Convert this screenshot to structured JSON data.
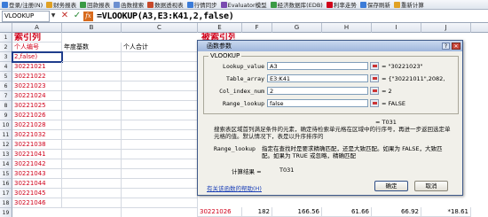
{
  "toolbar": {
    "items": [
      {
        "label": "登录/注册(N)",
        "icon": "user-icon",
        "color": "#3b7bd8"
      },
      {
        "label": "财务报表",
        "icon": "report-icon",
        "color": "#e0a124"
      },
      {
        "label": "回款报表",
        "icon": "report-icon",
        "color": "#3a9a45"
      },
      {
        "label": "函数搜索",
        "icon": "search-icon",
        "color": "#6b8fd0"
      },
      {
        "label": "数据透视表",
        "icon": "table-icon",
        "color": "#c7492b"
      },
      {
        "label": "行情同步",
        "icon": "sync-icon",
        "color": "#3b7bd8"
      },
      {
        "label": "Evaluator模型",
        "icon": "model-icon",
        "color": "#7a4ab0"
      },
      {
        "label": "经济数据库(EDB)",
        "icon": "database-icon",
        "color": "#3a9a45"
      },
      {
        "label": "利率走势",
        "icon": "chart-icon",
        "color": "#d0021b"
      },
      {
        "label": "保存刷新",
        "icon": "save-icon",
        "color": "#3b7bd8"
      },
      {
        "label": "重新计算",
        "icon": "calc-icon",
        "color": "#e0a124"
      }
    ]
  },
  "formula_bar": {
    "name_box": "VLOOKUP",
    "dropdown": "▼",
    "cancel": "✕",
    "confirm": "✓",
    "fx": "fx",
    "formula": "=VLOOKUP(A3,E3:K41,2,false)"
  },
  "columns": [
    "A",
    "B",
    "C",
    "D",
    "E",
    "F",
    "G",
    "H",
    "I",
    "J"
  ],
  "rows": [
    "1",
    "2",
    "3",
    "4",
    "5",
    "6",
    "7",
    "8",
    "9",
    "10",
    "11",
    "12",
    "13",
    "14",
    "15",
    "16",
    "17",
    "18",
    "19"
  ],
  "sheet": {
    "title": "索引列",
    "headers": [
      "个人编号",
      "年度基数",
      "个人合计"
    ],
    "formula_cell": "2,false)",
    "ids": [
      "30221021",
      "30221022",
      "30221023",
      "30221024",
      "30221025",
      "30221026",
      "30221028",
      "30221032",
      "30221038",
      "30221041",
      "30221042",
      "30221043",
      "30221044",
      "30221045",
      "30221046"
    ],
    "right_title": "被索引列",
    "bottom_right": [
      "30221026",
      "182",
      "166.56",
      "61.66",
      "66.92",
      "*18.61"
    ]
  },
  "dialog": {
    "title": "函数参数",
    "help_btn": "?",
    "close_btn": "✕",
    "group_label": "VLOOKUP",
    "args": [
      {
        "name": "Lookup_value",
        "value": "A3",
        "result": "= \"30221023\""
      },
      {
        "name": "Table_array",
        "value": "E3:K41",
        "result": "= {\"30221011\",2082,"
      },
      {
        "name": "Col_index_num",
        "value": "2",
        "result": "= 2"
      },
      {
        "name": "Range_lookup",
        "value": "false",
        "result": "= FALSE"
      }
    ],
    "total_result": "= T031",
    "description": "搜索表区域首列满足条件的元素，确定待检索单元格在区域中的行序号，再进一步返回选定单元格的值。默认情况下，表是以升序排序的",
    "param_name": "Range_lookup",
    "param_desc": "指定在查找时是要求精确匹配，还是大致匹配。如果为 FALSE，大致匹配。如果为 TRUE 或忽略，精确匹配",
    "calc_label": "计算结果 =",
    "calc_value": "T031",
    "help_link": "有关该函数的帮助(H)",
    "ok": "确定",
    "cancel": "取消"
  },
  "colors": {
    "accent_red": "#d0021b",
    "dialog_bg": "#f1f0ea",
    "title_blue": "#9fb6dc"
  }
}
